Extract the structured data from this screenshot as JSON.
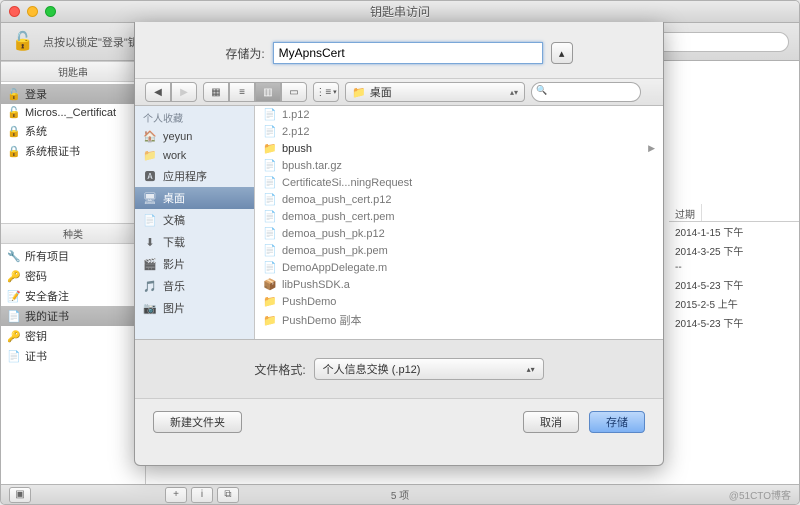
{
  "window": {
    "title": "钥匙串访问",
    "lock_text": "点按以锁定\"登录\"钥匙串。"
  },
  "search": {
    "placeholder": ""
  },
  "keychains": {
    "header": "钥匙串",
    "items": [
      {
        "label": "登录",
        "icon": "🔓",
        "selected": true
      },
      {
        "label": "Micros..._Certificat",
        "icon": "🔓",
        "selected": false
      },
      {
        "label": "系统",
        "icon": "🔒",
        "selected": false
      },
      {
        "label": "系统根证书",
        "icon": "🔒",
        "selected": false
      }
    ]
  },
  "categories": {
    "header": "种类",
    "items": [
      {
        "label": "所有项目",
        "icon": "🔧"
      },
      {
        "label": "密码",
        "icon": "🔑"
      },
      {
        "label": "安全备注",
        "icon": "📝"
      },
      {
        "label": "我的证书",
        "icon": "📄",
        "selected": true
      },
      {
        "label": "密钥",
        "icon": "🔑"
      },
      {
        "label": "证书",
        "icon": "📄"
      }
    ]
  },
  "table": {
    "cols": {
      "expire": "过期"
    },
    "rows": [
      "2014-1-15 下午",
      "2014-3-25 下午",
      "--",
      "2014-5-23 下午",
      "2015-2-5 上午",
      "2014-5-23 下午"
    ]
  },
  "statusbar": {
    "count": "5 项",
    "watermark": "@51CTO博客"
  },
  "dialog": {
    "save_as_label": "存储为:",
    "filename": "MyApnsCert",
    "path_label": "桌面",
    "favorites_header": "个人收藏",
    "favorites": [
      {
        "label": "yeyun",
        "icon": "🏠"
      },
      {
        "label": "work",
        "icon": "📁"
      },
      {
        "label": "应用程序",
        "icon": "🅰"
      },
      {
        "label": "桌面",
        "icon": "🖥",
        "selected": true
      },
      {
        "label": "文稿",
        "icon": "📄"
      },
      {
        "label": "下载",
        "icon": "⬇"
      },
      {
        "label": "影片",
        "icon": "🎬"
      },
      {
        "label": "音乐",
        "icon": "🎵"
      },
      {
        "label": "图片",
        "icon": "📷"
      }
    ],
    "files": [
      {
        "name": "1.p12",
        "icon": "📄"
      },
      {
        "name": "2.p12",
        "icon": "📄"
      },
      {
        "name": "bpush",
        "icon": "📁",
        "folder": true
      },
      {
        "name": "bpush.tar.gz",
        "icon": "📄"
      },
      {
        "name": "CertificateSi...ningRequest",
        "icon": "📄"
      },
      {
        "name": "demoa_push_cert.p12",
        "icon": "📄"
      },
      {
        "name": "demoa_push_cert.pem",
        "icon": "📄"
      },
      {
        "name": "demoa_push_pk.p12",
        "icon": "📄"
      },
      {
        "name": "demoa_push_pk.pem",
        "icon": "📄"
      },
      {
        "name": "DemoAppDelegate.m",
        "icon": "📄"
      },
      {
        "name": "libPushSDK.a",
        "icon": "📦"
      },
      {
        "name": "PushDemo",
        "icon": "📁"
      },
      {
        "name": "PushDemo 副本",
        "icon": "📁"
      }
    ],
    "format_label": "文件格式:",
    "format_value": "个人信息交换 (.p12)",
    "new_folder": "新建文件夹",
    "cancel": "取消",
    "save": "存储"
  }
}
